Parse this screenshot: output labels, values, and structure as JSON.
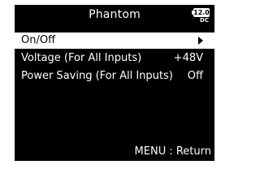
{
  "screen": {
    "title": "Phantom",
    "battery": {
      "level": "12.0",
      "source": "DC"
    }
  },
  "menu": {
    "items": [
      {
        "label": "On/Off",
        "value": ""
      },
      {
        "label": "Voltage (For All Inputs)",
        "value": "+48V"
      },
      {
        "label": "Power Saving (For All Inputs)",
        "value": "Off"
      }
    ]
  },
  "footer": {
    "hint": "MENU : Return"
  }
}
